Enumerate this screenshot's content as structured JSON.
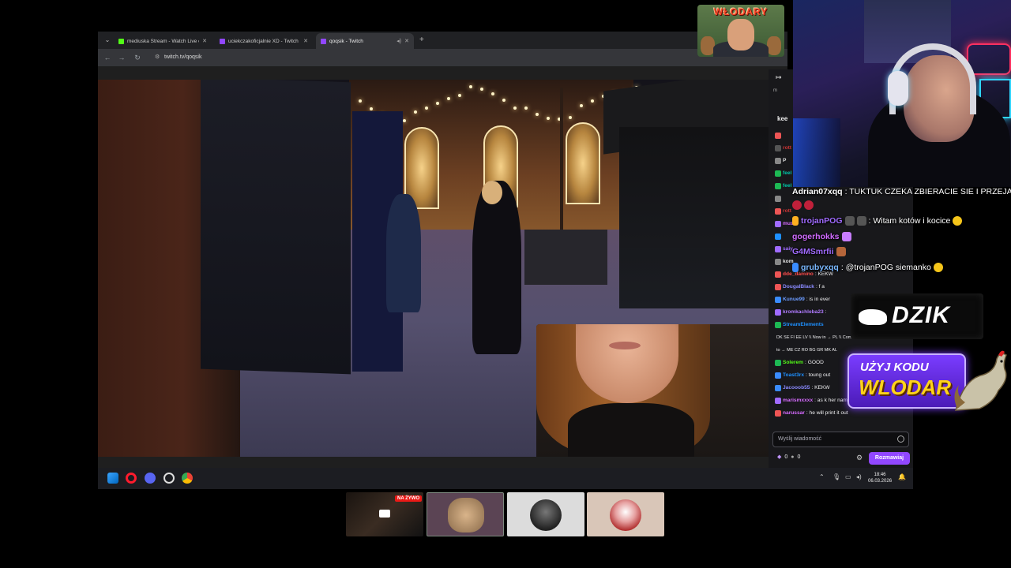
{
  "browser": {
    "tabs": [
      {
        "title": "mediuska Stream - Watch Live o",
        "favicon_color": "#53fc18"
      },
      {
        "title": "uciekczakoficjalnie XD - Twitch",
        "favicon_color": "#9147ff"
      },
      {
        "title": "qoqsik - Twitch",
        "favicon_color": "#9147ff"
      }
    ],
    "url": "twitch.tv/qoqsik"
  },
  "chat": {
    "header_1": "m",
    "header_2": "kee",
    "rows": [
      {
        "user": "",
        "msg": "",
        "user_color": "#ff6b6b"
      },
      {
        "user": "rott",
        "msg": "",
        "user_color": "#cc3333"
      },
      {
        "user": "P",
        "msg": "",
        "user_color": "#e0e0e0"
      },
      {
        "user": "feel",
        "msg": "",
        "user_color": "#00c4a7"
      },
      {
        "user": "feel",
        "msg": "",
        "user_color": "#00c4a7"
      },
      {
        "user": "",
        "msg": "",
        "user_color": "#9b6bff"
      },
      {
        "user": "rott",
        "msg": "",
        "user_color": "#cc3333"
      },
      {
        "user": "mus",
        "msg": "",
        "user_color": "#d66bff"
      },
      {
        "user": "",
        "msg": "",
        "user_color": "#00a0ff"
      },
      {
        "user": "saiy",
        "msg": "",
        "user_color": "#a06bff"
      },
      {
        "user": "kom",
        "msg": "",
        "user_color": "#e0e0e0"
      },
      {
        "user": "dde_damino",
        "msg": ": KEKW",
        "user_color": "#ff4c4c"
      },
      {
        "user": "DougalBlack",
        "msg": ": f a",
        "user_color": "#8a8aff"
      },
      {
        "user": "Kunue99",
        "msg": ": is in ever",
        "user_color": "#6b9bff"
      },
      {
        "user": "kromkachleba23",
        "msg": ":",
        "user_color": "#b07bff"
      },
      {
        "user": "StreamElements",
        "msg": "",
        "user_color": "#1e90ff"
      },
      {
        "user": "",
        "msg": "DK SE FI EE LV \\\\ Now in → PL \\\\ Coming soon",
        "user_color": "#efeff1"
      },
      {
        "user": "",
        "msg": "to → ME CZ RO BG GR MK AL",
        "user_color": "#efeff1"
      },
      {
        "user": "Solerem",
        "msg": ": GOOD",
        "user_color": "#53fc18"
      },
      {
        "user": "Toast3rx",
        "msg": ": toung out",
        "user_color": "#1e90ff"
      },
      {
        "user": "Jacooob55",
        "msg": ": KEKW",
        "user_color": "#8a8aff"
      },
      {
        "user": "marismxxxx",
        "msg": ": as k her name",
        "user_color": "#d66bff"
      },
      {
        "user": "narussar",
        "msg": ": he will print it out",
        "user_color": "#d66bff"
      }
    ],
    "input_placeholder": "Wyślij wiadomość",
    "points_a": "0",
    "points_b": "0",
    "send_label": "Rozmawiaj"
  },
  "taskbar": {
    "time": "18:46",
    "date": "06.03.2026"
  },
  "overlay_chat": [
    {
      "user": "Adrian07xqq",
      "msg": ": TUKTUK CZEKA ZBIERACIE SIE I PRZEJAZD",
      "user_color": "#ffffff"
    },
    {
      "user": "",
      "msg": "",
      "user_color": "#ffffff"
    },
    {
      "user": "trojanPOG",
      "msg": ": Witam kotów i kocice",
      "user_color": "#a06bff"
    },
    {
      "user": "gogerhokks",
      "msg": ":",
      "user_color": "#d06bff"
    },
    {
      "user": "G4MSmrfii",
      "msg": ":",
      "user_color": "#a06bff"
    },
    {
      "user": "grubyxqq",
      "msg": ": @trojanPOG siemanko",
      "user_color": "#7ab8ff"
    }
  ],
  "logo": {
    "text": "WŁODARY"
  },
  "promo": {
    "brand": "DZIK",
    "line1": "UŻYJ KODU",
    "line2": "WLODAR"
  },
  "thumbnails": [
    {
      "live_label": "NA ŻYWO"
    }
  ],
  "colors": {
    "twitch_purple": "#9147ff",
    "chat_bg": "#18181b",
    "live_red": "#e91916"
  }
}
